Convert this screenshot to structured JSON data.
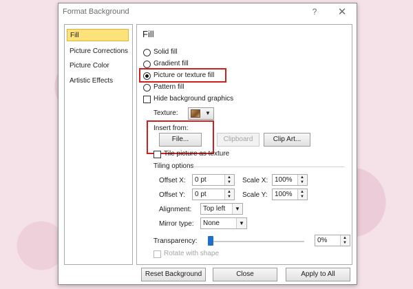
{
  "dialog": {
    "title": "Format Background",
    "help": "?",
    "close": "✕"
  },
  "nav": {
    "items": [
      "Fill",
      "Picture Corrections",
      "Picture Color",
      "Artistic Effects"
    ]
  },
  "fill": {
    "heading": "Fill",
    "options": [
      "Solid fill",
      "Gradient fill",
      "Picture or texture fill",
      "Pattern fill"
    ],
    "selected_option": "Picture or texture fill",
    "hide_background": "Hide background graphics",
    "texture_label": "Texture:",
    "insert_from": "Insert from:",
    "file_button": "File...",
    "clipboard_button": "Clipboard",
    "clipart_button": "Clip Art...",
    "tile": "Tile picture as texture",
    "tiling_options": "Tiling options",
    "offset_x_label": "Offset X:",
    "offset_x": "0 pt",
    "offset_y_label": "Offset Y:",
    "offset_y": "0 pt",
    "scale_x_label": "Scale X:",
    "scale_x": "100%",
    "scale_y_label": "Scale Y:",
    "scale_y": "100%",
    "alignment_label": "Alignment:",
    "alignment": "Top left",
    "mirror_label": "Mirror type:",
    "mirror": "None",
    "transparency_label": "Transparency:",
    "transparency": "0%",
    "transparency_value": 0,
    "rotate": "Rotate with shape"
  },
  "footer": {
    "reset": "Reset Background",
    "close": "Close",
    "apply_all": "Apply to All"
  },
  "colors": {
    "highlight": "#d11f1f",
    "nav_selected": "#fde27a",
    "slider": "#1f6fc9"
  }
}
